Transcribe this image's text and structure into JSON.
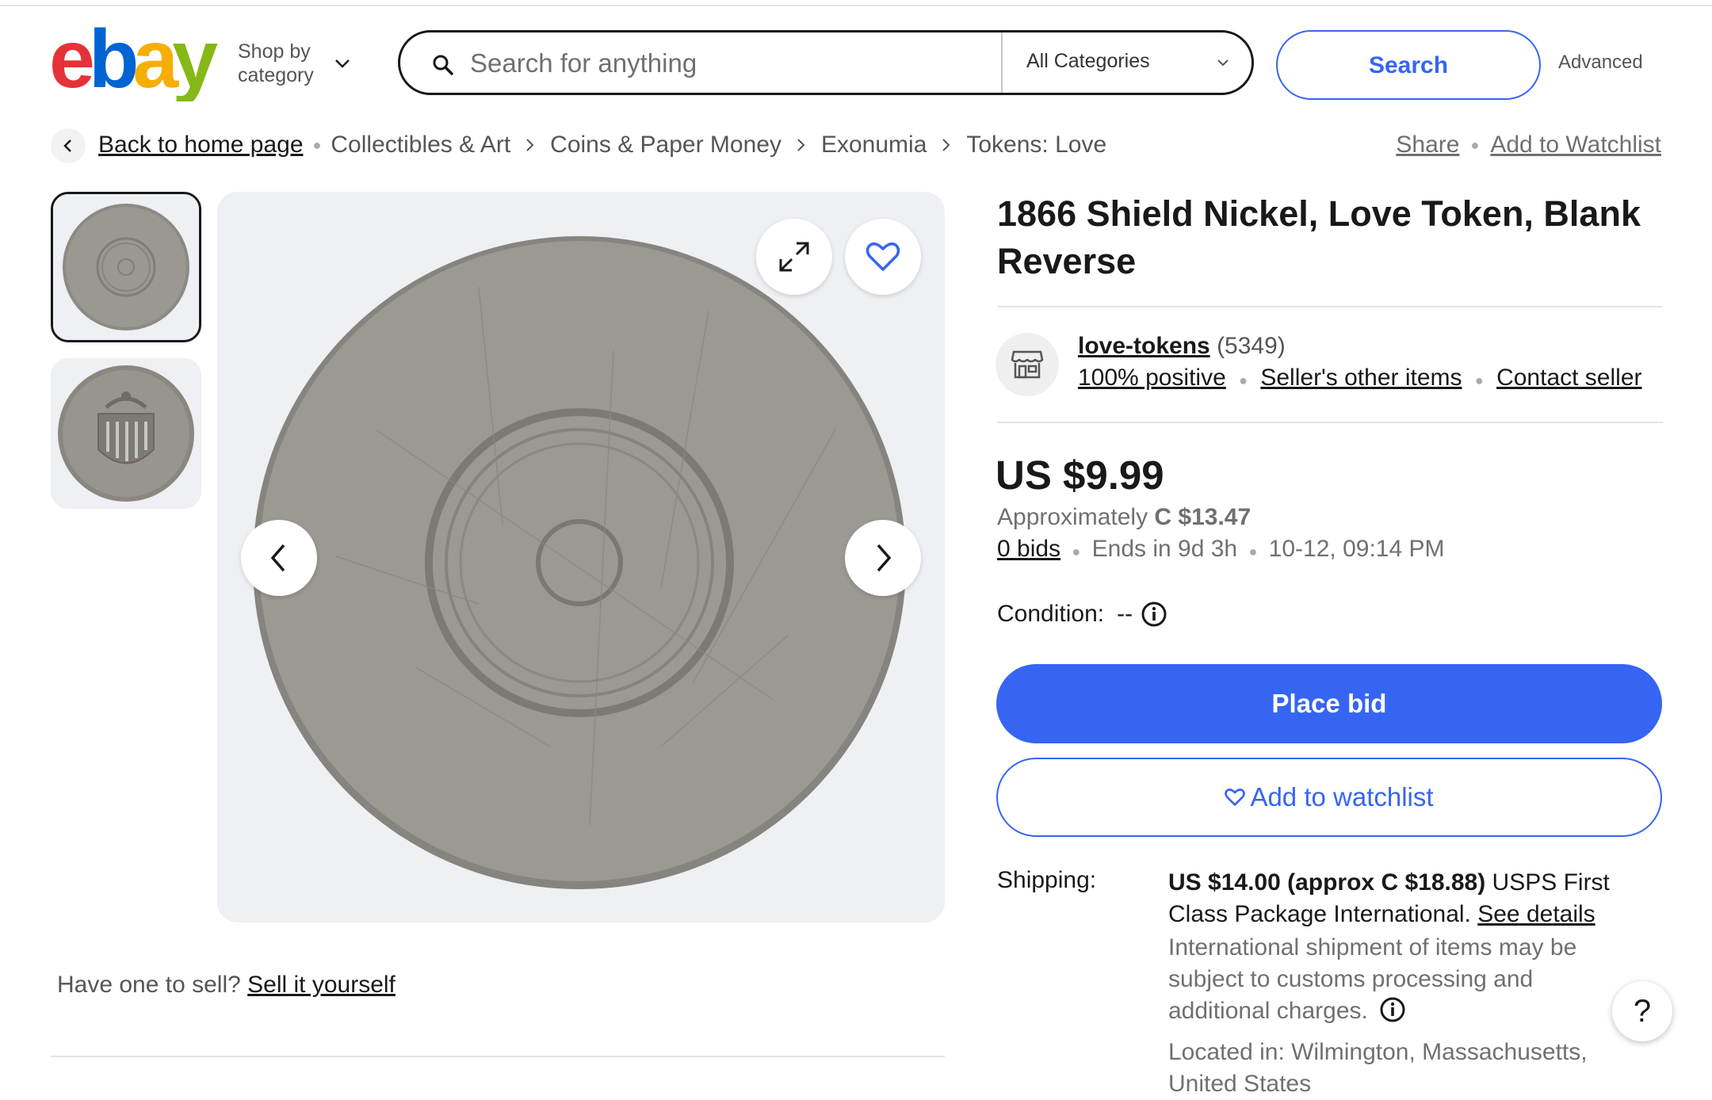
{
  "header": {
    "logo_text": "ebay",
    "logo_colors": [
      "#e53238",
      "#0064d2",
      "#f5af02",
      "#86b817"
    ],
    "shop_by_category_line1": "Shop by",
    "shop_by_category_line2": "category",
    "search_placeholder": "Search for anything",
    "category_selected": "All Categories",
    "search_button": "Search",
    "advanced_link": "Advanced"
  },
  "breadcrumb": {
    "back_label": "Back to home page",
    "items": [
      "Collectibles & Art",
      "Coins & Paper Money",
      "Exonumia",
      "Tokens: Love"
    ],
    "share": "Share",
    "add_to_watchlist": "Add to Watchlist"
  },
  "item": {
    "title": "1866 Shield Nickel, Love Token, Blank Reverse",
    "seller": {
      "name": "love-tokens",
      "feedback_count": "(5349)",
      "positive": "100% positive",
      "other_items": "Seller's other items",
      "contact": "Contact seller"
    },
    "price": "US $9.99",
    "approx_prefix": "Approximately",
    "approx_value": "C $13.47",
    "bids": "0 bids",
    "ends_in": "Ends in 9d 3h",
    "end_date": "10-12, 09:14 PM",
    "condition_label": "Condition:",
    "condition_value": "--",
    "place_bid": "Place bid",
    "add_watchlist_button": "Add to watchlist",
    "shipping": {
      "label": "Shipping:",
      "cost": "US $14.00 (approx C $18.88)",
      "service": "USPS First Class Package International.",
      "see_details": "See details",
      "note": "International shipment of items may be subject to customs processing and additional charges.",
      "located": "Located in: Wilmington, Massachusetts, United States"
    }
  },
  "sell": {
    "prompt": "Have one to sell?",
    "link": "Sell it yourself"
  },
  "help_icon_label": "?"
}
